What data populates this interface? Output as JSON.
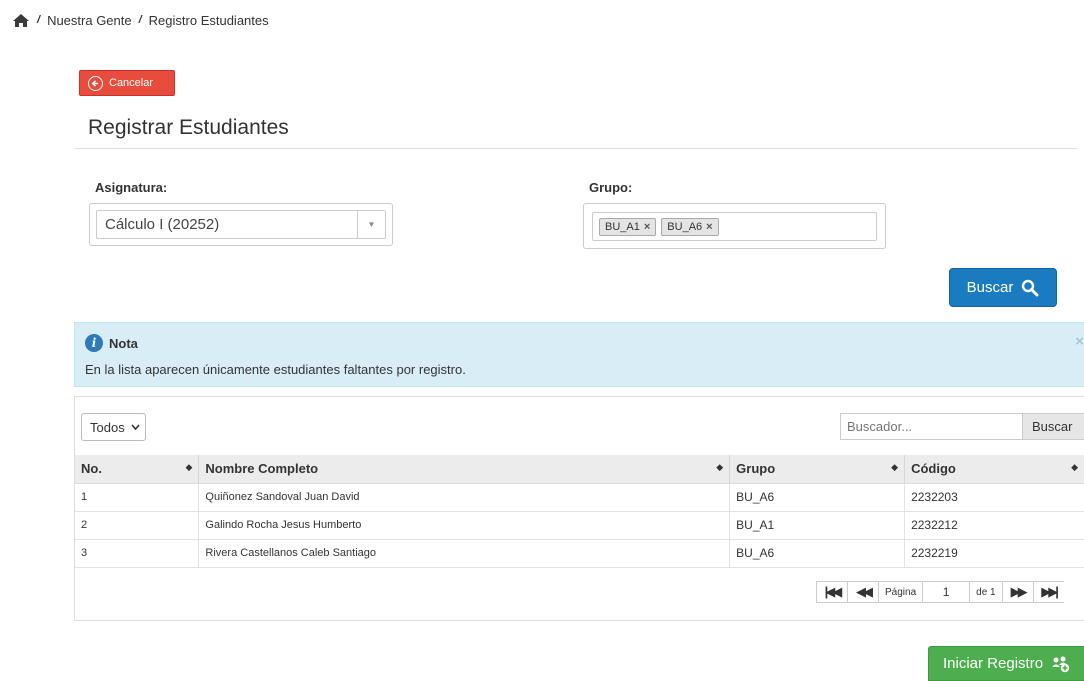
{
  "breadcrumb": {
    "home_icon": "home-icon",
    "items": [
      "Nuestra Gente",
      "Registro Estudiantes"
    ],
    "separator": "/"
  },
  "toolbar": {
    "cancel_label": "Cancelar",
    "cancel_icon": "circle-arrow-left-icon"
  },
  "page_title": "Registrar Estudiantes",
  "form": {
    "asignatura_label": "Asignatura:",
    "asignatura_value": "Cálculo I (20252)",
    "grupo_label": "Grupo:",
    "grupo_tags": [
      "BU_A1",
      "BU_A6"
    ],
    "tag_remove": "×",
    "search_button": "Buscar",
    "search_icon": "magnifier-icon"
  },
  "note": {
    "title": "Nota",
    "icon_glyph": "i",
    "message": "En la lista aparecen únicamente estudiantes faltantes por registro.",
    "close": "×"
  },
  "table": {
    "page_size_value": "Todos",
    "search_placeholder": "Buscador...",
    "search_button": "Buscar",
    "columns": [
      "No.",
      "Nombre Completo",
      "Grupo",
      "Código"
    ],
    "rows": [
      {
        "no": "1",
        "nombre": "Quiñonez Sandoval Juan David",
        "grupo": "BU_A6",
        "codigo": "2232203"
      },
      {
        "no": "2",
        "nombre": "Galindo Rocha Jesus Humberto",
        "grupo": "BU_A1",
        "codigo": "2232212"
      },
      {
        "no": "3",
        "nombre": "Rivera Castellanos Caleb Santiago",
        "grupo": "BU_A6",
        "codigo": "2232219"
      }
    ],
    "pager": {
      "page_label": "Página",
      "page_value": "1",
      "of_label": "de 1"
    }
  },
  "footer": {
    "start_label": "Iniciar Registro",
    "start_icon": "users-plus-icon"
  },
  "colors": {
    "danger": "#e74c3c",
    "primary": "#1a7bc0",
    "success": "#4cae4c",
    "info_bg": "#d9edf7"
  }
}
